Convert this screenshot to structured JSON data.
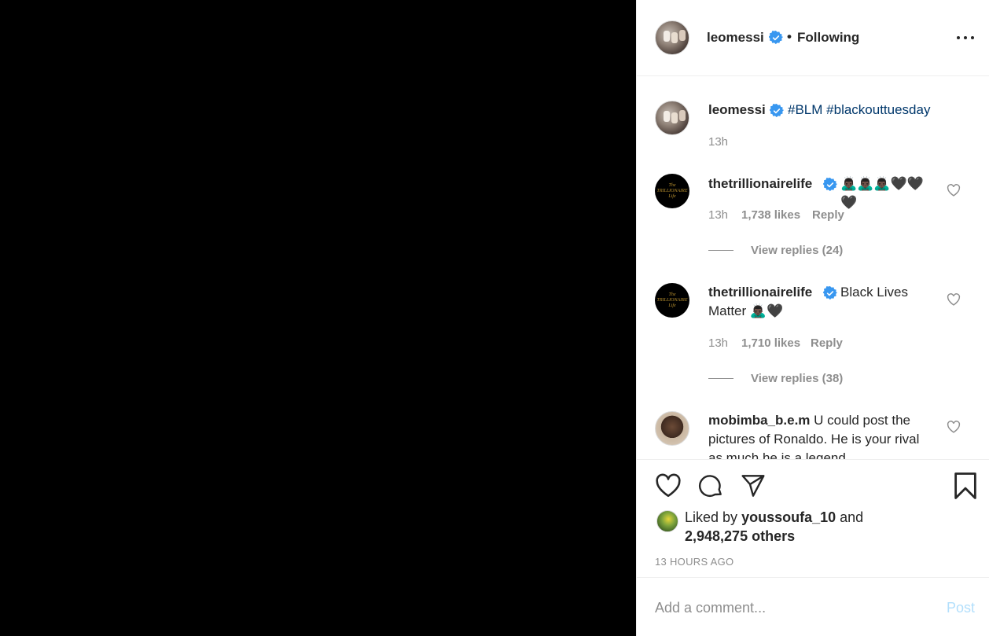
{
  "header": {
    "username": "leomessi",
    "separator": "•",
    "follow_status": "Following"
  },
  "caption": {
    "username": "leomessi",
    "hashtags": [
      "#BLM",
      "#blackouttuesday"
    ],
    "time": "13h"
  },
  "comments": [
    {
      "username": "thetrillionairelife",
      "text": "🙇🏿‍♂️🙇🏿‍♂️🙇🏿‍♂️🖤🖤🖤",
      "time": "13h",
      "likes": "1,738 likes",
      "reply_label": "Reply",
      "view_replies": "View replies (24)"
    },
    {
      "username": "thetrillionairelife",
      "text": "Black Lives Matter 🙇🏿‍♂️🖤",
      "time": "13h",
      "likes": "1,710 likes",
      "reply_label": "Reply",
      "view_replies": "View replies (38)"
    },
    {
      "username": "mobimba_b.e.m",
      "text": "U could post the pictures of Ronaldo. He is your rival as much he is a legend"
    }
  ],
  "likes": {
    "prefix": "Liked by",
    "user": "youssoufa_10",
    "and": "and",
    "others": "2,948,275 others"
  },
  "time_ago": "13 HOURS AGO",
  "composer": {
    "placeholder": "Add a comment...",
    "post_label": "Post"
  },
  "avatar_text": {
    "trillionaire": "The TRILLIONAIRE Life"
  },
  "icons": [
    "more-options-icon",
    "verified-badge-icon",
    "heart-icon",
    "comment-icon",
    "share-icon",
    "bookmark-icon"
  ],
  "colors": {
    "verified": "#3897f0",
    "hashtag": "#00376b",
    "muted": "#8e8e8e",
    "post_disabled": "#b2dffc",
    "media_background": "#000000"
  }
}
